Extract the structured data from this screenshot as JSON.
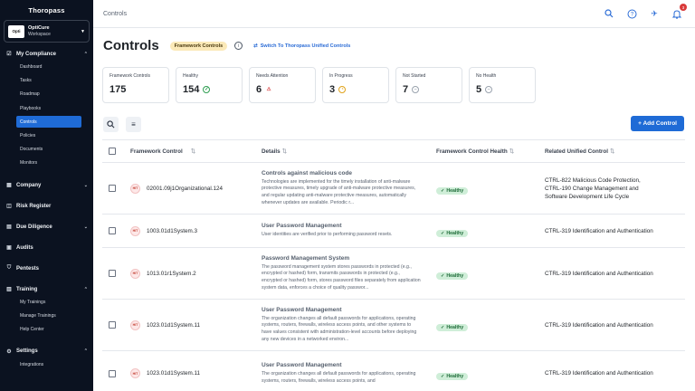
{
  "app": {
    "logo": "Thoropass"
  },
  "workspace": {
    "avatar": "Opti",
    "name": "OptiCure",
    "subtitle": "Workspace"
  },
  "nav": {
    "my_compliance": "My Compliance",
    "items": [
      "Dashboard",
      "Tasks",
      "Roadmap",
      "Playbooks",
      "Controls",
      "Policies",
      "Documents",
      "Monitors"
    ],
    "company": "Company",
    "risk_register": "Risk Register",
    "due_diligence": "Due Diligence",
    "audits": "Audits",
    "pentests": "Pentests",
    "training": "Training",
    "training_items": [
      "My Trainings",
      "Manage Trainings",
      "Help Center"
    ],
    "settings": "Settings",
    "settings_items": [
      "Integrations"
    ]
  },
  "topbar": {
    "breadcrumb": "Controls",
    "notification_count": "3"
  },
  "page": {
    "title": "Controls",
    "framework_pill": "Framework Controls",
    "switch_link": "Switch To Thoropass Unified Controls",
    "add_button": "+ Add Control"
  },
  "cards": [
    {
      "label": "Framework Controls",
      "value": "175"
    },
    {
      "label": "Healthy",
      "value": "154"
    },
    {
      "label": "Needs Attention",
      "value": "6"
    },
    {
      "label": "In Progress",
      "value": "3"
    },
    {
      "label": "Not Started",
      "value": "7"
    },
    {
      "label": "No Health",
      "value": "5"
    }
  ],
  "table": {
    "headers": {
      "framework_control": "Framework Control",
      "details": "Details",
      "health": "Framework Control Health",
      "unified": "Related Unified Control"
    },
    "rows": [
      {
        "id": "02001.09j1Organizational.124",
        "title": "Controls against malicious code",
        "desc": "Technologies are implemented for the timely installation of anti-malware protective measures, timely upgrade of anti-malware protective measures, and regular updating anti-malware protective measures, automatically whenever updates are available. Periodic r...",
        "health": "Healthy",
        "unified_1": "CTRL-822 Malicious Code Protection,",
        "unified_2": "CTRL-190  Change Management and",
        "unified_3": "Software Development Life Cycle"
      },
      {
        "id": "1003.01d1System.3",
        "title": "User Password Management",
        "desc": "User identities are verified prior to performing password resets.",
        "health": "Healthy",
        "unified_1": "CTRL-319 Identification and Authentication"
      },
      {
        "id": "1013.01r1System.2",
        "title": "Password Management System",
        "desc": "The password management system stores passwords in protected (e.g., encrypted or hashed) form, transmits passwords in protected (e.g., encrypted or hashed) form, stores password files separately from application system data, enforces a choice of quality passwor...",
        "health": "Healthy",
        "unified_1": "CTRL-319 Identification and Authentication"
      },
      {
        "id": "1023.01d1System.11",
        "title": "User Password Management",
        "desc": "The organization changes all default passwords for applications, operating systems, routers, firewalls, wireless access points, and other systems to have values consistent with administration-level accounts before deploying any new devices in a networked environ...",
        "health": "Healthy",
        "unified_1": "CTRL-319 Identification and Authentication"
      },
      {
        "id": "1023.01d1System.11",
        "title": "User Password Management",
        "desc": "The organization changes all default passwords for applications, operating systems, routers, firewalls, wireless access points, and",
        "health": "Healthy",
        "unified_1": "CTRL-319 Identification and Authentication"
      }
    ]
  }
}
